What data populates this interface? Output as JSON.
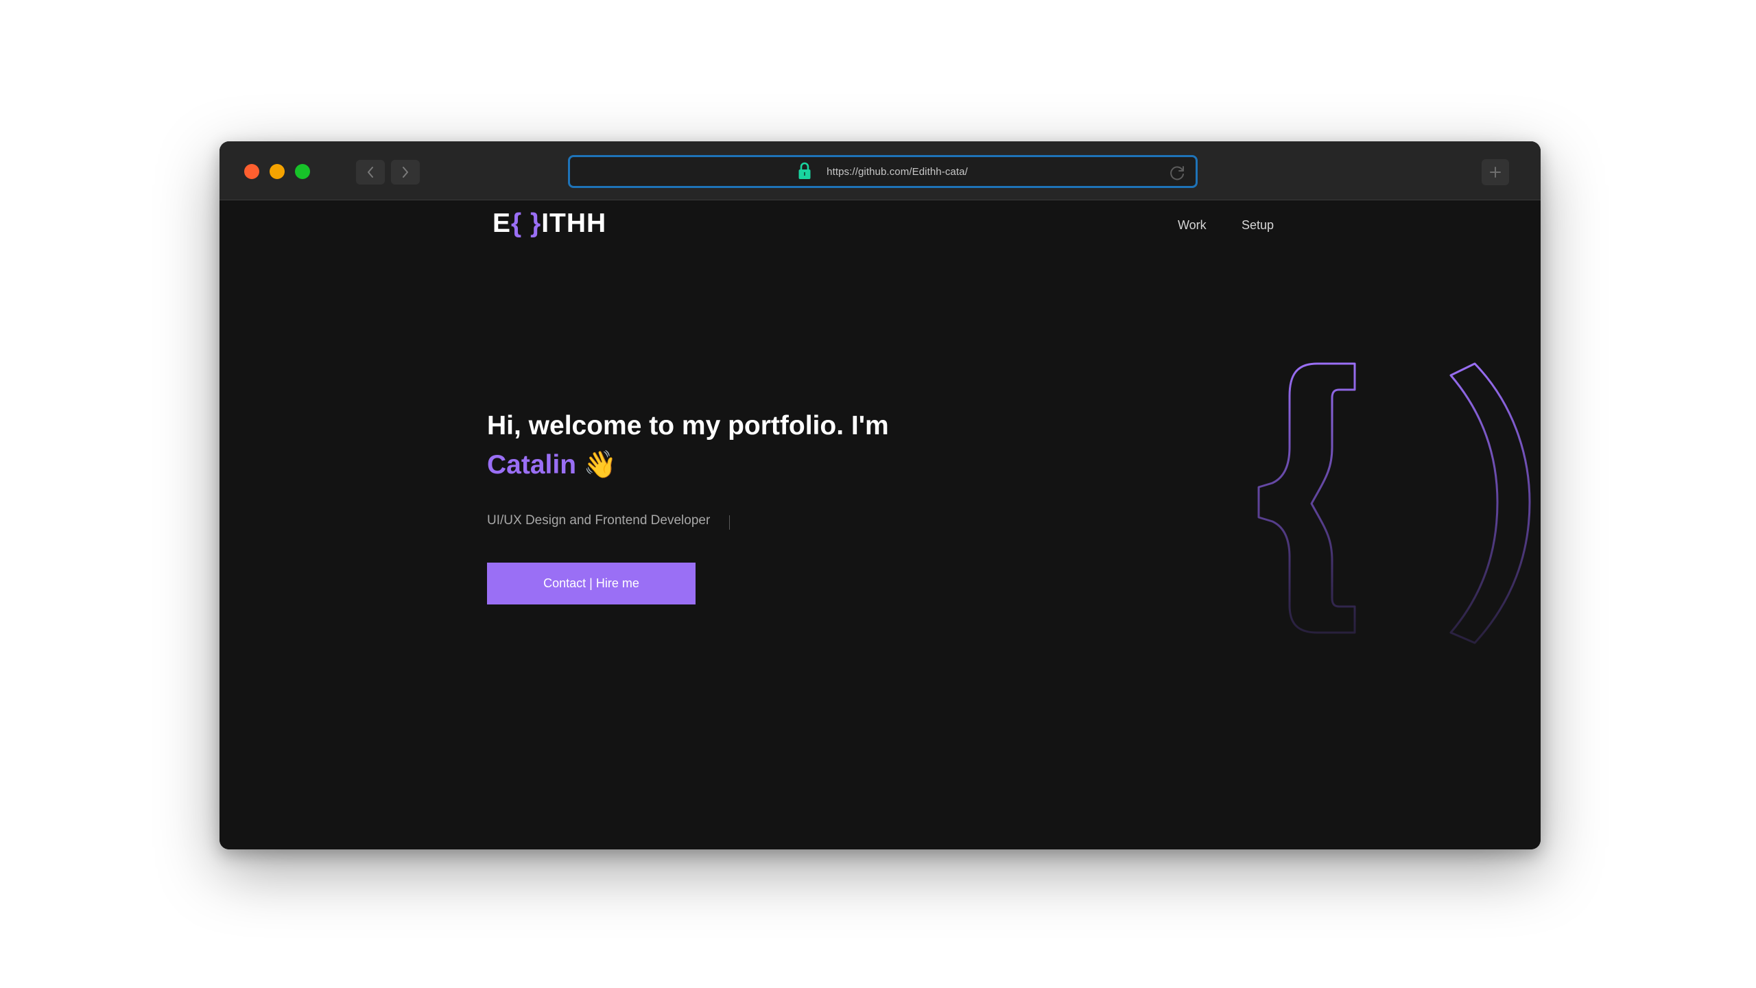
{
  "browser": {
    "url": "https://github.com/Edithh-cata/"
  },
  "header": {
    "logo_left": "E",
    "logo_brace": "{ }",
    "logo_right": "ITHH",
    "nav": [
      "Work",
      "Setup"
    ]
  },
  "hero": {
    "greeting": "Hi, welcome to my portfolio. I'm",
    "name": "Catalin",
    "emoji": "👋",
    "subtitle": "UI/UX Design and Frontend Developer",
    "cta_label": "Contact | Hire me"
  },
  "colors": {
    "accent": "#9a6ff5",
    "page_bg": "#131313",
    "url_focus": "#1e73b8",
    "lock": "#19d4a0"
  },
  "icons": {
    "lock": "lock-icon",
    "reload": "reload-icon",
    "back": "chevron-left-icon",
    "forward": "chevron-right-icon",
    "new_tab": "plus-icon",
    "decoration": "braces-icon"
  }
}
